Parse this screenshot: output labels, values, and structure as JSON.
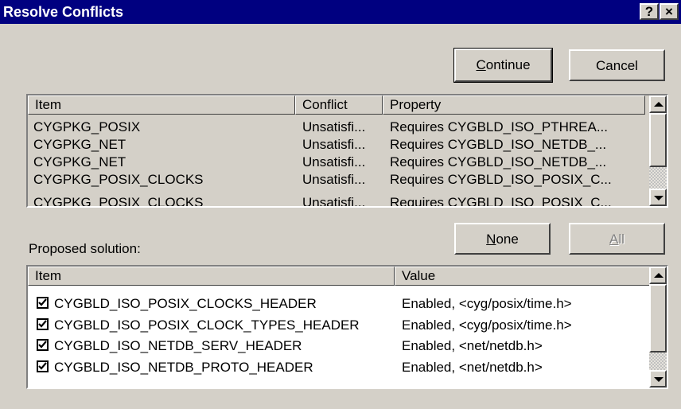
{
  "window": {
    "title": "Resolve Conflicts",
    "help_label": "?",
    "close_label": "×"
  },
  "buttons": {
    "continue_label": "Continue",
    "continue_accel": "C",
    "continue_rest": "ontinue",
    "cancel_label": "Cancel",
    "none_label": "None",
    "none_accel": "N",
    "none_rest": "one",
    "all_label": "All",
    "all_accel": "A",
    "all_rest": "ll"
  },
  "conflicts": {
    "columns": [
      "Item",
      "Conflict",
      "Property"
    ],
    "rows": [
      {
        "item": "CYGPKG_POSIX",
        "conflict": "Unsatisfi...",
        "property": "Requires  CYGBLD_ISO_PTHREA..."
      },
      {
        "item": "CYGPKG_NET",
        "conflict": "Unsatisfi...",
        "property": "Requires  CYGBLD_ISO_NETDB_..."
      },
      {
        "item": "CYGPKG_NET",
        "conflict": "Unsatisfi...",
        "property": "Requires  CYGBLD_ISO_NETDB_..."
      },
      {
        "item": "CYGPKG_POSIX_CLOCKS",
        "conflict": "Unsatisfi...",
        "property": "Requires  CYGBLD_ISO_POSIX_C..."
      },
      {
        "item": "CYGPKG_POSIX_CLOCKS",
        "conflict": "Unsatisfi...",
        "property": "Requires  CYGBLD_ISO_POSIX_C..."
      }
    ]
  },
  "solution": {
    "label": "Proposed solution:",
    "columns": [
      "Item",
      "Value"
    ],
    "rows": [
      {
        "checked": true,
        "item": "CYGBLD_ISO_POSIX_CLOCKS_HEADER",
        "value": "Enabled, <cyg/posix/time.h>"
      },
      {
        "checked": true,
        "item": "CYGBLD_ISO_POSIX_CLOCK_TYPES_HEADER",
        "value": "Enabled, <cyg/posix/time.h>"
      },
      {
        "checked": true,
        "item": "CYGBLD_ISO_NETDB_SERV_HEADER",
        "value": "Enabled, <net/netdb.h>"
      },
      {
        "checked": true,
        "item": "CYGBLD_ISO_NETDB_PROTO_HEADER",
        "value": "Enabled, <net/netdb.h>"
      }
    ]
  }
}
